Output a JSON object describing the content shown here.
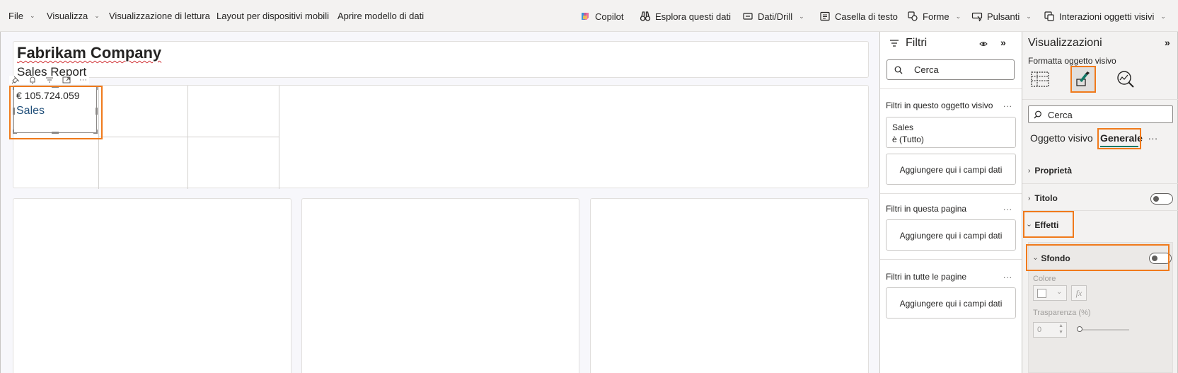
{
  "ribbon": {
    "file": "File",
    "visualizza": "Visualizza",
    "reading_view": "Visualizzazione di lettura",
    "mobile_layout": "Layout per dispositivi mobili",
    "open_data_model": "Aprire modello di dati",
    "copilot": "Copilot",
    "explore_data": "Esplora questi dati",
    "data_drill": "Dati/Drill",
    "text_box": "Casella di testo",
    "shapes": "Forme",
    "buttons": "Pulsanti",
    "visual_interactions": "Interazioni oggetti visivi"
  },
  "canvas": {
    "title": "Fabrikam Company",
    "subtitle": "Sales Report",
    "card_value": "€ 105.724.059",
    "card_label": "Sales"
  },
  "filters": {
    "title": "Filtri",
    "search_placeholder": "Cerca",
    "on_visual_label": "Filtri in questo oggetto visivo",
    "filter_field": "Sales",
    "filter_state": "è (Tutto)",
    "add_fields": "Aggiungere qui i campi dati",
    "on_page_label": "Filtri in questa pagina",
    "all_pages_label": "Filtri in tutte le pagine",
    "more": "..."
  },
  "viz": {
    "title": "Visualizzazioni",
    "format_label": "Formatta oggetto visivo",
    "search_placeholder": "Cerca",
    "tab_visual": "Oggetto visivo",
    "tab_general": "Generale",
    "more": "...",
    "properties": "Proprietà",
    "title_section": "Titolo",
    "effects": "Effetti",
    "background": "Sfondo",
    "color_label": "Colore",
    "transparency_label": "Trasparenza (%)",
    "transparency_value": "0",
    "fx": "fx"
  },
  "colors": {
    "accent_highlight": "#f07a1b",
    "active_tab_underline": "#117865",
    "link_blue": "#1f4e79"
  }
}
